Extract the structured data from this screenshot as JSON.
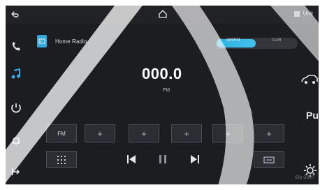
{
  "topbar": {
    "status": "Unit"
  },
  "source": {
    "label": "Home Radio"
  },
  "toggle": {
    "left_label": "AM/FM",
    "right_label": "DAB"
  },
  "tuner": {
    "frequency": "000.0",
    "unit": "FM"
  },
  "presets": [
    {
      "label": "FM"
    },
    {
      "label": "+"
    },
    {
      "label": "+"
    },
    {
      "label": "+"
    },
    {
      "label": "+"
    },
    {
      "label": "+"
    }
  ],
  "side_labels": {
    "right_label": "Pu"
  },
  "footer": {
    "version": "Bla 0097"
  },
  "colors": {
    "accent": "#34a8d8",
    "background": "#1b1d20"
  }
}
